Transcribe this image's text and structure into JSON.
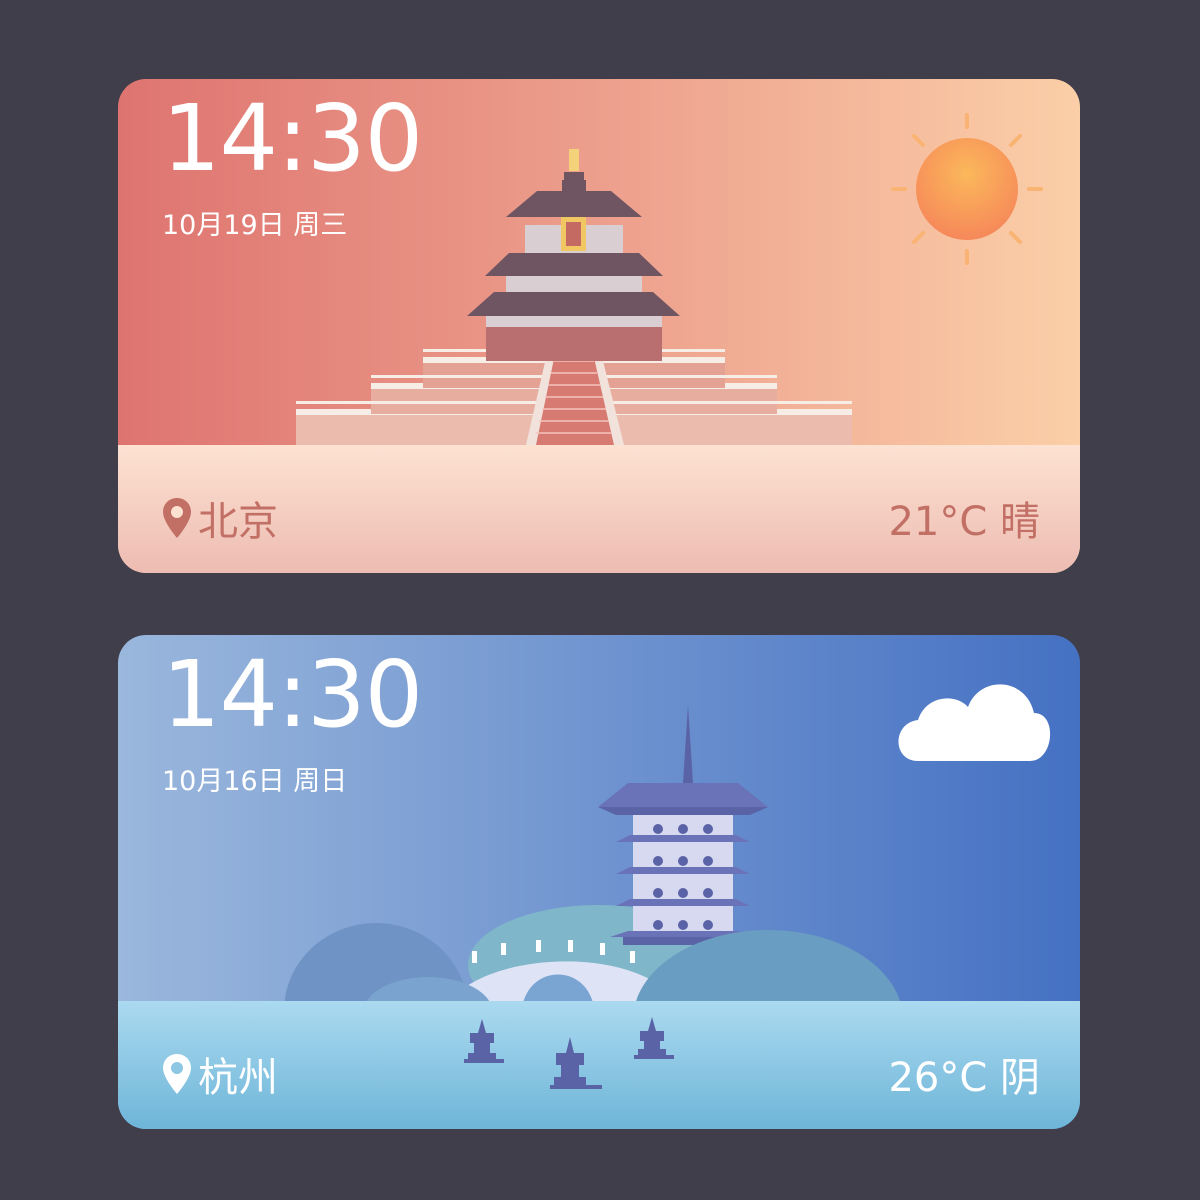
{
  "cards": [
    {
      "time": "14:30",
      "date": "10月19日 周三",
      "city": "北京",
      "weather": "21°C 晴",
      "weather_icon": "sun-icon",
      "location_icon": "location-pin-icon",
      "landmark": "temple-of-heaven-illustration",
      "colors": {
        "sky_start": "#de7470",
        "sky_end": "#fbcfa8",
        "ground": "#fde2d2",
        "accent": "#c27065"
      }
    },
    {
      "time": "14:30",
      "date": "10月16日 周日",
      "city": "杭州",
      "weather": "26°C 阴",
      "weather_icon": "cloud-icon",
      "location_icon": "location-pin-icon",
      "landmark": "leifeng-pagoda-illustration",
      "colors": {
        "sky_start": "#9ab7dc",
        "sky_end": "#4571c3",
        "ground": "#a8d8ee",
        "accent": "#ffffff"
      }
    }
  ]
}
